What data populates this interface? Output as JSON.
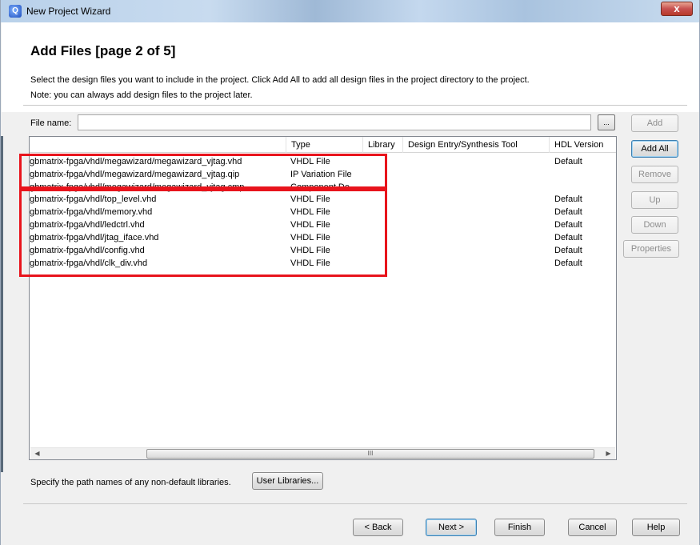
{
  "window": {
    "title": "New Project Wizard",
    "close_label": "x"
  },
  "header": {
    "title": "Add Files [page 2 of 5]",
    "description": "Select the design files you want to include in the project. Click Add All to add all design files in the project directory to the project.",
    "note": "Note: you can always add design files to the project later."
  },
  "file_name": {
    "label": "File name:",
    "value": "",
    "browse_label": "..."
  },
  "side_buttons": {
    "add": "Add",
    "add_all": "Add All",
    "remove": "Remove",
    "up": "Up",
    "down": "Down",
    "properties": "Properties"
  },
  "table": {
    "columns": [
      "",
      "Type",
      "Library",
      "Design Entry/Synthesis Tool",
      "HDL Version"
    ],
    "rows": [
      {
        "name": "gbmatrix-fpga/vhdl/megawizard/megawizard_vjtag.vhd",
        "type": "VHDL File",
        "hdl": "Default"
      },
      {
        "name": "gbmatrix-fpga/vhdl/megawizard/megawizard_vjtag.qip",
        "type": "IP Variation File",
        "hdl": ""
      },
      {
        "name": "gbmatrix-fpga/vhdl/megawizard/megawizard_vjtag.cmp",
        "type": "Component De...",
        "hdl": ""
      },
      {
        "name": "gbmatrix-fpga/vhdl/top_level.vhd",
        "type": "VHDL File",
        "hdl": "Default"
      },
      {
        "name": "gbmatrix-fpga/vhdl/memory.vhd",
        "type": "VHDL File",
        "hdl": "Default"
      },
      {
        "name": "gbmatrix-fpga/vhdl/ledctrl.vhd",
        "type": "VHDL File",
        "hdl": "Default"
      },
      {
        "name": "gbmatrix-fpga/vhdl/jtag_iface.vhd",
        "type": "VHDL File",
        "hdl": "Default"
      },
      {
        "name": "gbmatrix-fpga/vhdl/config.vhd",
        "type": "VHDL File",
        "hdl": "Default"
      },
      {
        "name": "gbmatrix-fpga/vhdl/clk_div.vhd",
        "type": "VHDL File",
        "hdl": "Default"
      }
    ],
    "scroll_grip": "III"
  },
  "libraries": {
    "label": "Specify the path names of any non-default libraries.",
    "button": "User Libraries..."
  },
  "nav": {
    "back": "< Back",
    "next": "Next >",
    "finish": "Finish",
    "cancel": "Cancel",
    "help": "Help"
  },
  "colors": {
    "highlight": "#e8141c",
    "title_bar": "#b9d1ea"
  }
}
